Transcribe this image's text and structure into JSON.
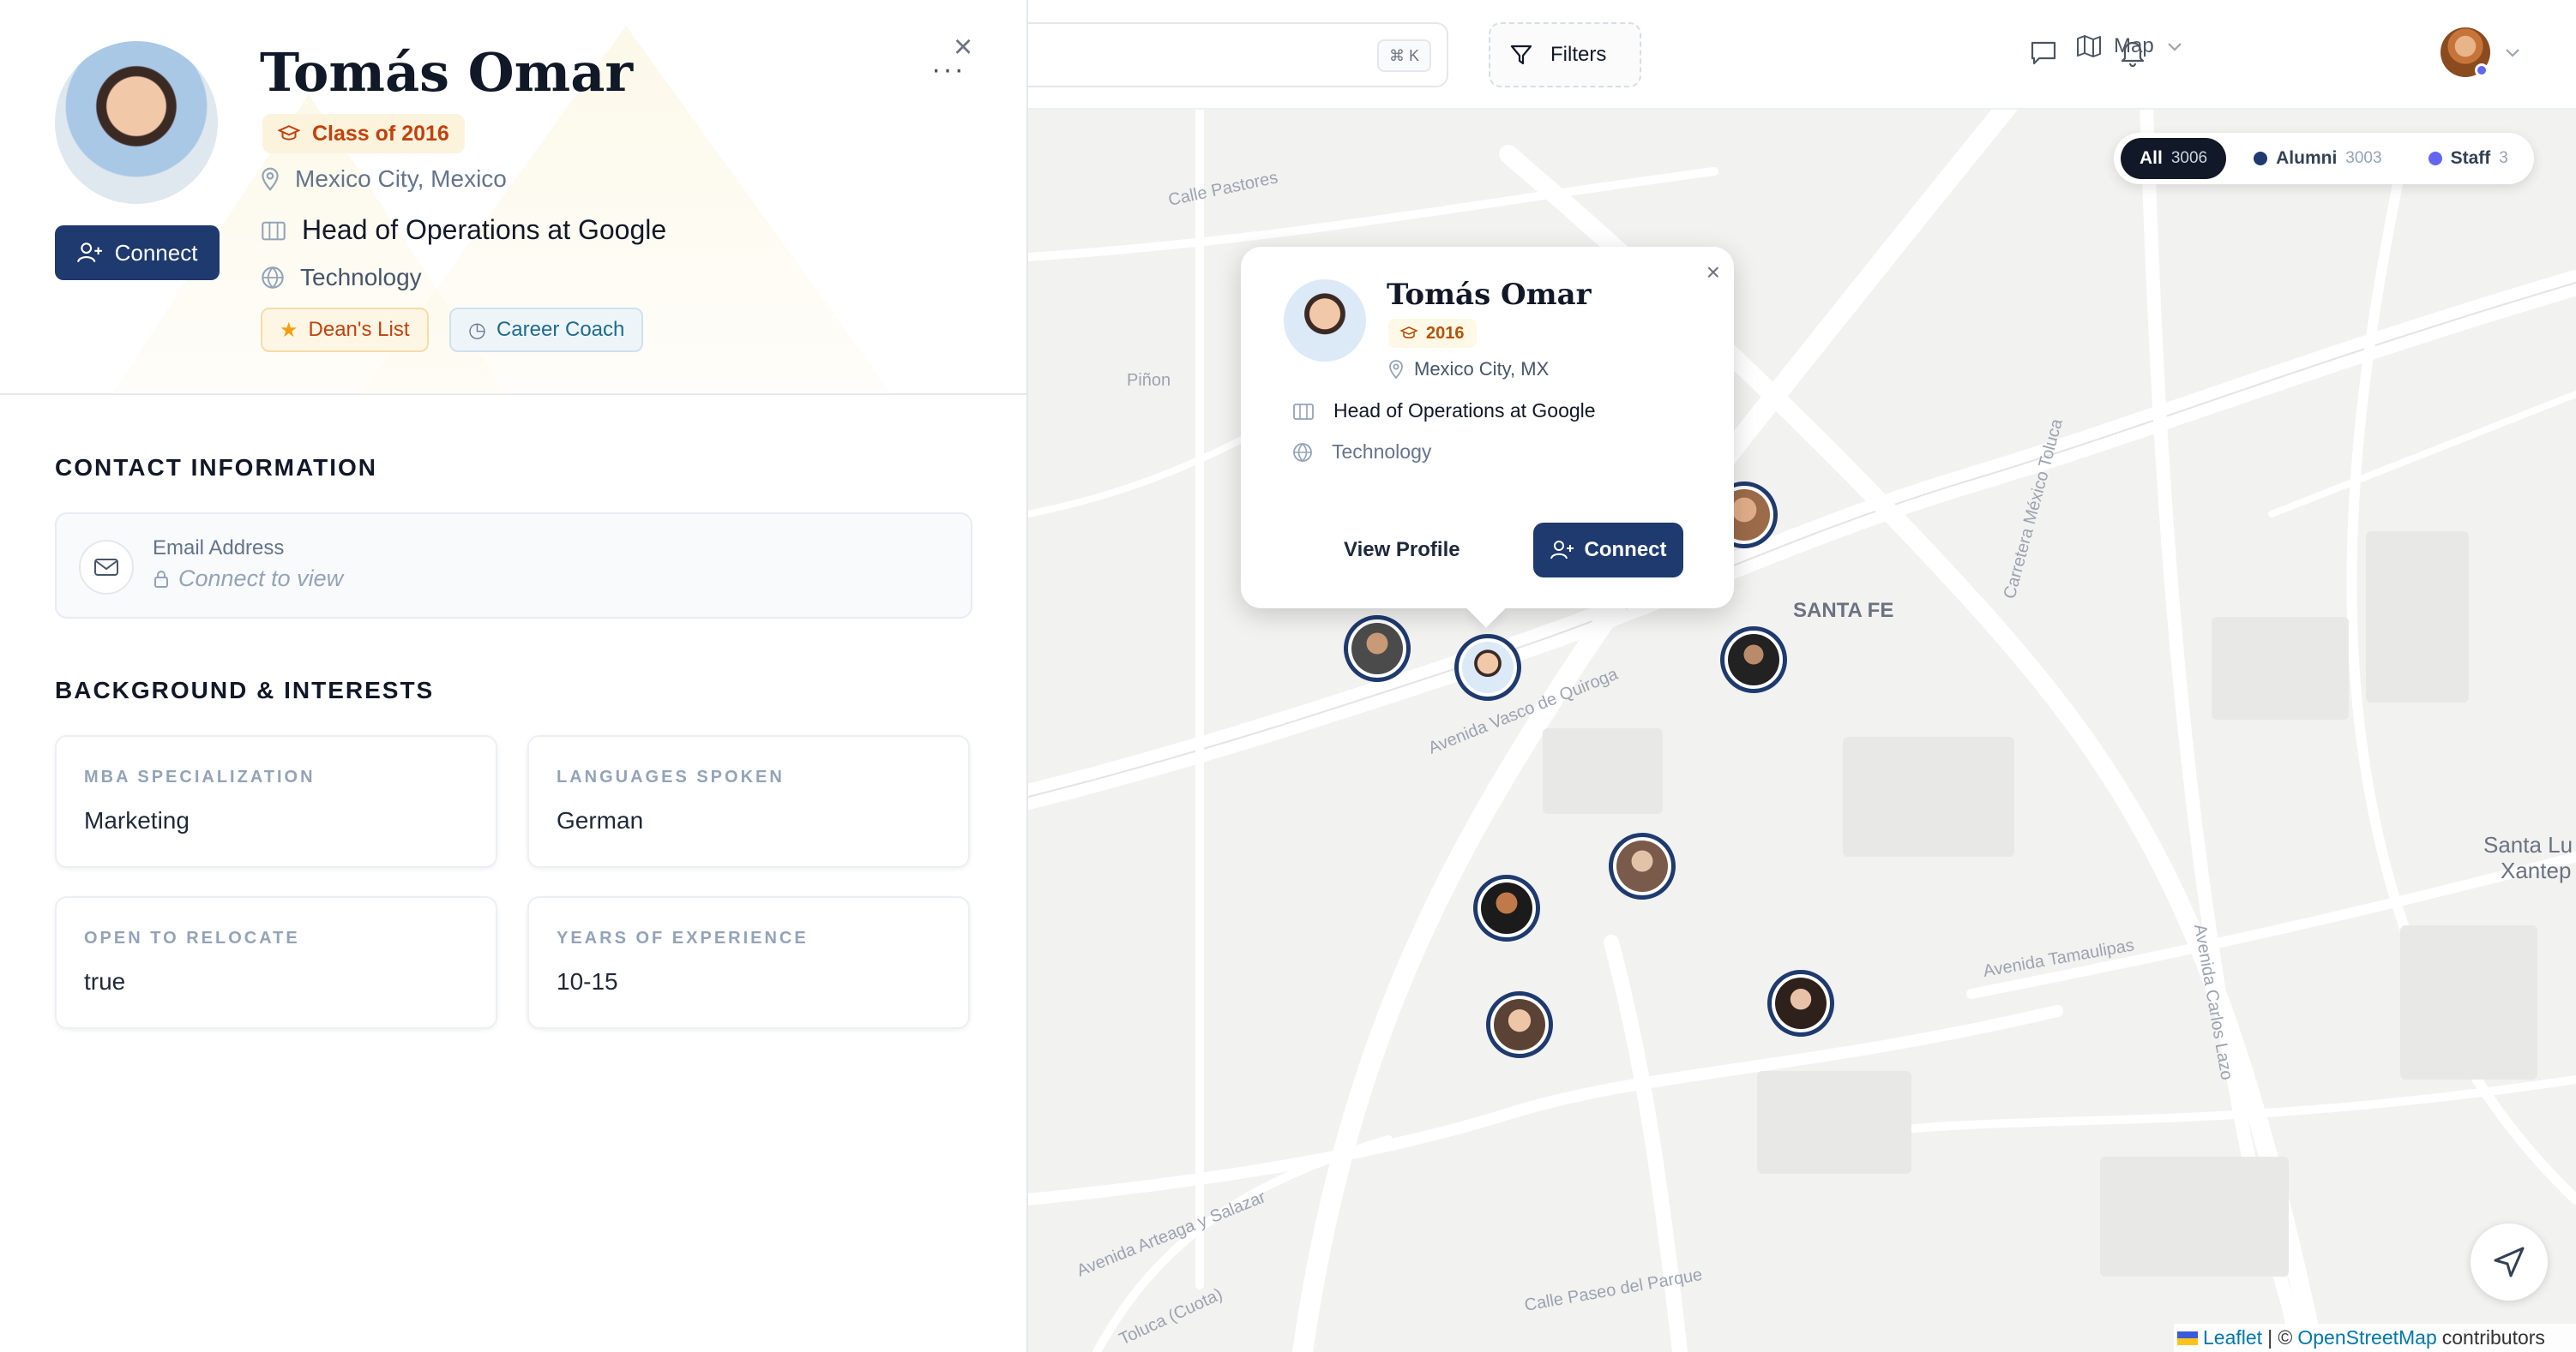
{
  "profile": {
    "name": "Tomás Omar",
    "class_badge": "Class of 2016",
    "location": "Mexico City, Mexico",
    "role": "Head of Operations at Google",
    "industry": "Technology",
    "tags": [
      "Dean's List",
      "Career Coach"
    ],
    "connect_label": "Connect",
    "more_label": "···",
    "close_label": "×"
  },
  "contact": {
    "title": "CONTACT INFORMATION",
    "email_label": "Email Address",
    "email_value": "Connect to view"
  },
  "background": {
    "title": "BACKGROUND & INTERESTS",
    "items": [
      {
        "label": "MBA SPECIALIZATION",
        "value": "Marketing"
      },
      {
        "label": "LANGUAGES SPOKEN",
        "value": "German"
      },
      {
        "label": "OPEN TO RELOCATE",
        "value": "true"
      },
      {
        "label": "YEARS OF EXPERIENCE",
        "value": "10-15"
      }
    ]
  },
  "topbar": {
    "search_shortcut": "⌘ K",
    "filters_label": "Filters",
    "view_label": "Map"
  },
  "legend": [
    {
      "label": "All",
      "count": "3006",
      "color": "#111827"
    },
    {
      "label": "Alumni",
      "count": "3003",
      "color": "#1e3a6e"
    },
    {
      "label": "Staff",
      "count": "3",
      "color": "#6366f1"
    }
  ],
  "popup": {
    "name": "Tomás Omar",
    "year": "2016",
    "location": "Mexico City, MX",
    "role": "Head of Operations at Google",
    "industry": "Technology",
    "view_profile_label": "View Profile",
    "connect_label": "Connect",
    "close_label": "×"
  },
  "map_labels": {
    "santa_fe": "SANTA FE",
    "vasco": "Avenida Vasco de Quiroga",
    "pinon": "Piñon",
    "tamaulipas": "Avenida Tamaulipas",
    "santa_lu": "Santa Lu",
    "xantep": "Xantep",
    "pastores": "Calle Pastores",
    "carlos_lazo": "Avenida Carlos Lazo",
    "carretera": "Carretera México Toluca",
    "arteaga": "Avenida Arteaga y Salazar",
    "paseo": "Calle Paseo del Parque",
    "cuota": "Toluca (Cuota)"
  },
  "attribution": {
    "leaflet": "Leaflet",
    "sep": "| ©",
    "osm": "OpenStreetMap",
    "contrib": "contributors"
  },
  "colors": {
    "brand_navy": "#1e3a6e",
    "class_badge_text": "#c2410c",
    "staff_dot": "#6366f1"
  }
}
